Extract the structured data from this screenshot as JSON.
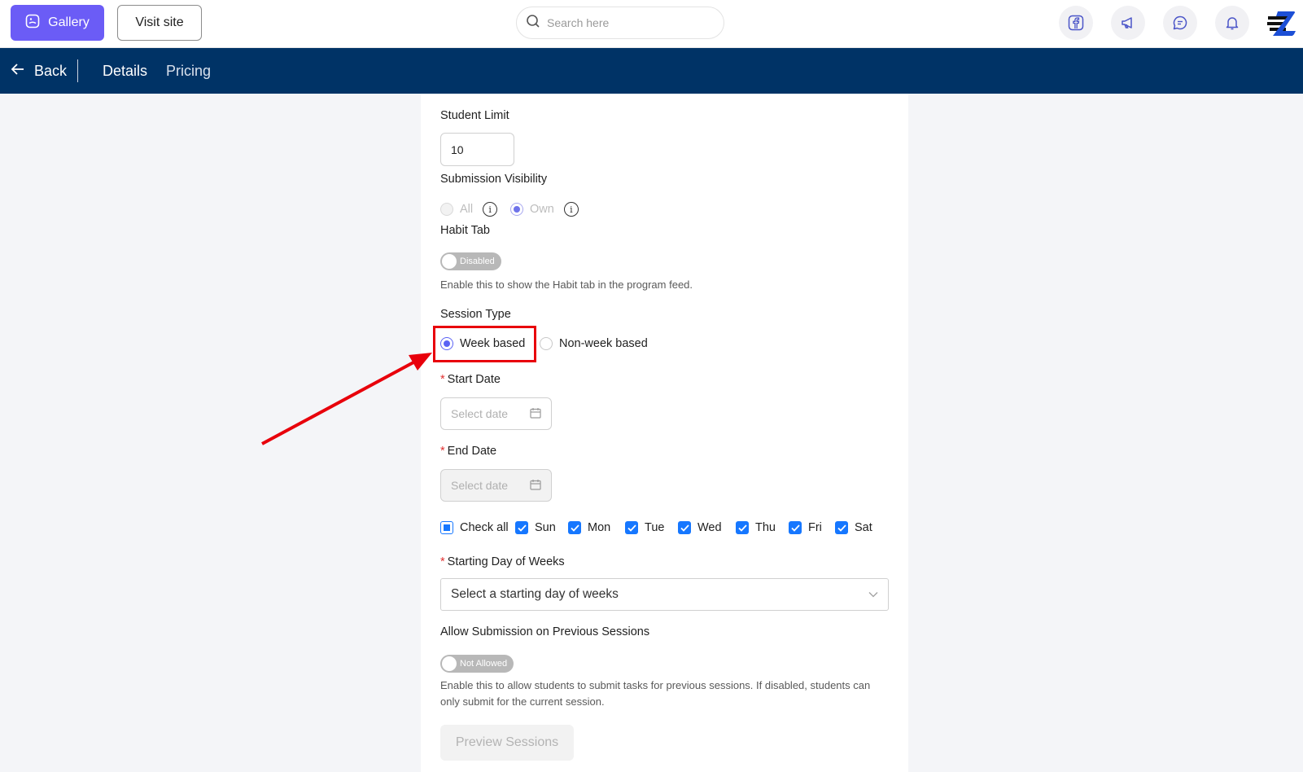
{
  "header": {
    "gallery_label": "Gallery",
    "visit_label": "Visit site",
    "search_placeholder": "Search here"
  },
  "nav": {
    "back_label": "Back",
    "tabs": [
      "Details",
      "Pricing"
    ]
  },
  "form": {
    "student_limit": {
      "label": "Student Limit",
      "value": "10"
    },
    "submission_visibility": {
      "label": "Submission Visibility",
      "options": [
        "All",
        "Own"
      ],
      "selected": "Own"
    },
    "habit_tab": {
      "label": "Habit Tab",
      "toggle_text": "Disabled",
      "helper": "Enable this to show the Habit tab in the program feed."
    },
    "session_type": {
      "label": "Session Type",
      "options": [
        "Week based",
        "Non-week based"
      ],
      "selected": "Week based"
    },
    "start_date": {
      "label": "Start Date",
      "placeholder": "Select date"
    },
    "end_date": {
      "label": "End Date",
      "placeholder": "Select date"
    },
    "days": {
      "check_all": "Check all",
      "items": [
        "Sun",
        "Mon",
        "Tue",
        "Wed",
        "Thu",
        "Fri",
        "Sat"
      ]
    },
    "starting_day": {
      "label": "Starting Day of Weeks",
      "placeholder": "Select a starting day of weeks"
    },
    "allow_previous": {
      "label": "Allow Submission on Previous Sessions",
      "toggle_text": "Not Allowed",
      "helper": "Enable this to allow students to submit tasks for previous sessions. If disabled, students can only submit for the current session."
    },
    "preview_label": "Preview Sessions"
  },
  "colors": {
    "accent": "#6b5cf6",
    "nav_bg": "#003366",
    "annotation": "#e8000b",
    "checkbox": "#1677ff"
  }
}
